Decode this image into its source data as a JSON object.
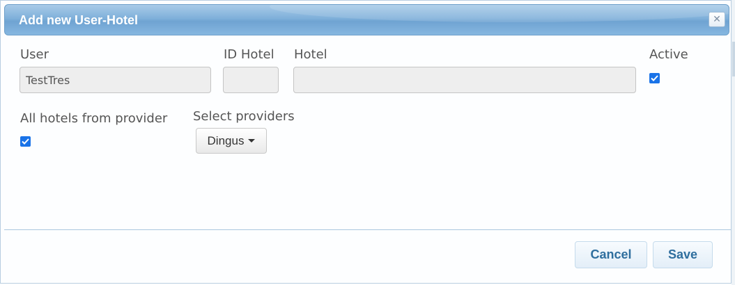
{
  "dialog": {
    "title": "Add new User-Hotel",
    "close_icon": "close-icon"
  },
  "form": {
    "user": {
      "label": "User",
      "value": "TestTres"
    },
    "id_hotel": {
      "label": "ID Hotel",
      "value": ""
    },
    "hotel": {
      "label": "Hotel",
      "value": ""
    },
    "active": {
      "label": "Active",
      "checked": true
    },
    "all_hotels": {
      "label": "All hotels from provider",
      "checked": true
    },
    "providers": {
      "label": "Select providers",
      "selected": "Dingus"
    }
  },
  "footer": {
    "cancel_label": "Cancel",
    "save_label": "Save"
  },
  "colors": {
    "titlebar": "#7fb0da",
    "checkbox": "#1a73e8",
    "button_text": "#2e6e9e"
  }
}
